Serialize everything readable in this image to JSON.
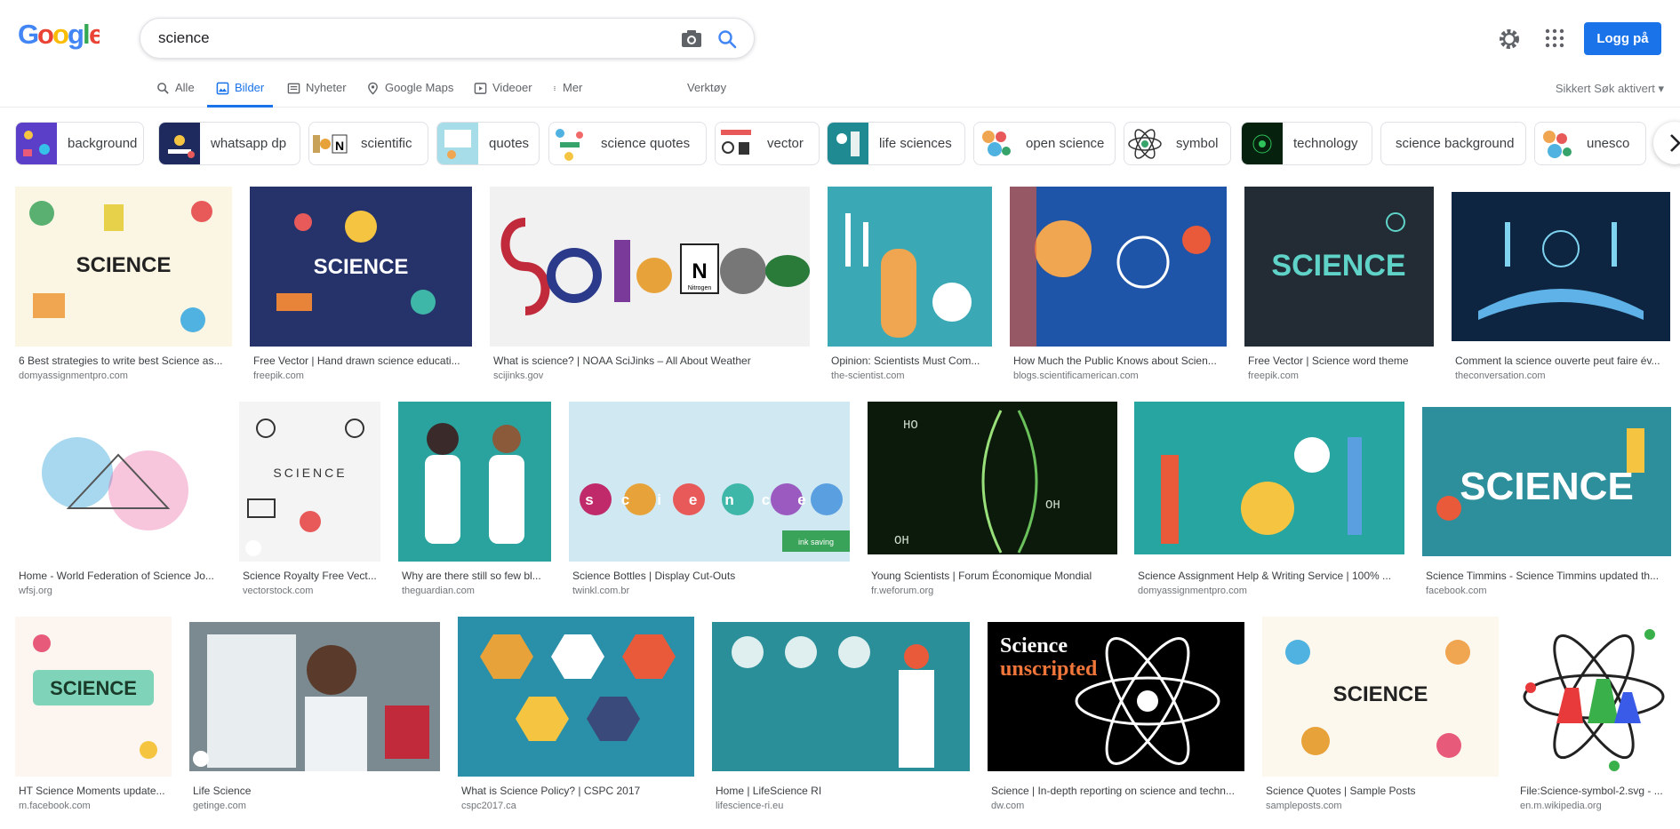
{
  "header": {
    "logo_text": "Google",
    "search_value": "science",
    "login_label": "Logg på"
  },
  "tabs": [
    {
      "label": "Alle",
      "icon": "search-icon"
    },
    {
      "label": "Bilder",
      "icon": "image-icon",
      "active": true
    },
    {
      "label": "Nyheter",
      "icon": "news-icon"
    },
    {
      "label": "Google Maps",
      "icon": "map-pin-icon"
    },
    {
      "label": "Videoer",
      "icon": "video-icon"
    },
    {
      "label": "Mer",
      "icon": "more-vert-icon"
    }
  ],
  "tools_label": "Verktøy",
  "safesearch_label": "Sikkert Søk aktivert",
  "chips": [
    "background",
    "whatsapp dp",
    "scientific",
    "quotes",
    "science quotes",
    "vector",
    "life sciences",
    "open science",
    "symbol",
    "technology",
    "science background",
    "unesco"
  ],
  "results": [
    [
      {
        "title": "6 Best strategies to write best Science as...",
        "source": "domyassignmentpro.com"
      },
      {
        "title": "Free Vector | Hand drawn science educati...",
        "source": "freepik.com"
      },
      {
        "title": "What is science? | NOAA SciJinks – All About Weather",
        "source": "scijinks.gov"
      },
      {
        "title": "Opinion: Scientists Must Com...",
        "source": "the-scientist.com"
      },
      {
        "title": "How Much the Public Knows about Scien...",
        "source": "blogs.scientificamerican.com"
      },
      {
        "title": "Free Vector | Science word theme",
        "source": "freepik.com"
      },
      {
        "title": "Comment la science ouverte peut faire év...",
        "source": "theconversation.com"
      }
    ],
    [
      {
        "title": "Home - World Federation of Science Jo...",
        "source": "wfsj.org"
      },
      {
        "title": "Science Royalty Free Vect...",
        "source": "vectorstock.com"
      },
      {
        "title": "Why are there still so few bl...",
        "source": "theguardian.com"
      },
      {
        "title": "Science Bottles | Display Cut-Outs",
        "source": "twinkl.com.br"
      },
      {
        "title": "Young Scientists | Forum Économique Mondial",
        "source": "fr.weforum.org"
      },
      {
        "title": "Science Assignment Help & Writing Service | 100% ...",
        "source": "domyassignmentpro.com"
      },
      {
        "title": "Science Timmins - Science Timmins updated th...",
        "source": "facebook.com"
      }
    ],
    [
      {
        "title": "HT Science Moments update...",
        "source": "m.facebook.com"
      },
      {
        "title": "Life Science",
        "source": "getinge.com"
      },
      {
        "title": "What is Science Policy? | CSPC 2017",
        "source": "cspc2017.ca"
      },
      {
        "title": "Home | LifeScience RI",
        "source": "lifescience-ri.eu"
      },
      {
        "title": "Science | In-depth reporting on science and techn...",
        "source": "dw.com"
      },
      {
        "title": "Science Quotes | Sample Posts",
        "source": "sampleposts.com"
      },
      {
        "title": "File:Science-symbol-2.svg - ...",
        "source": "en.m.wikipedia.org"
      }
    ]
  ],
  "image_texts": {
    "science": "SCIENCE",
    "scijinks": "SCIENCE",
    "nitrogen": "Nitrogen",
    "science_word": "SCIENCE",
    "science_unscripted_1": "Science",
    "science_unscripted_2": "unscripted",
    "ink_saving": "ink saving",
    "bottles": "science"
  },
  "colors": {
    "accent": "#1a73e8",
    "text": "#202124",
    "muted": "#70757a"
  }
}
